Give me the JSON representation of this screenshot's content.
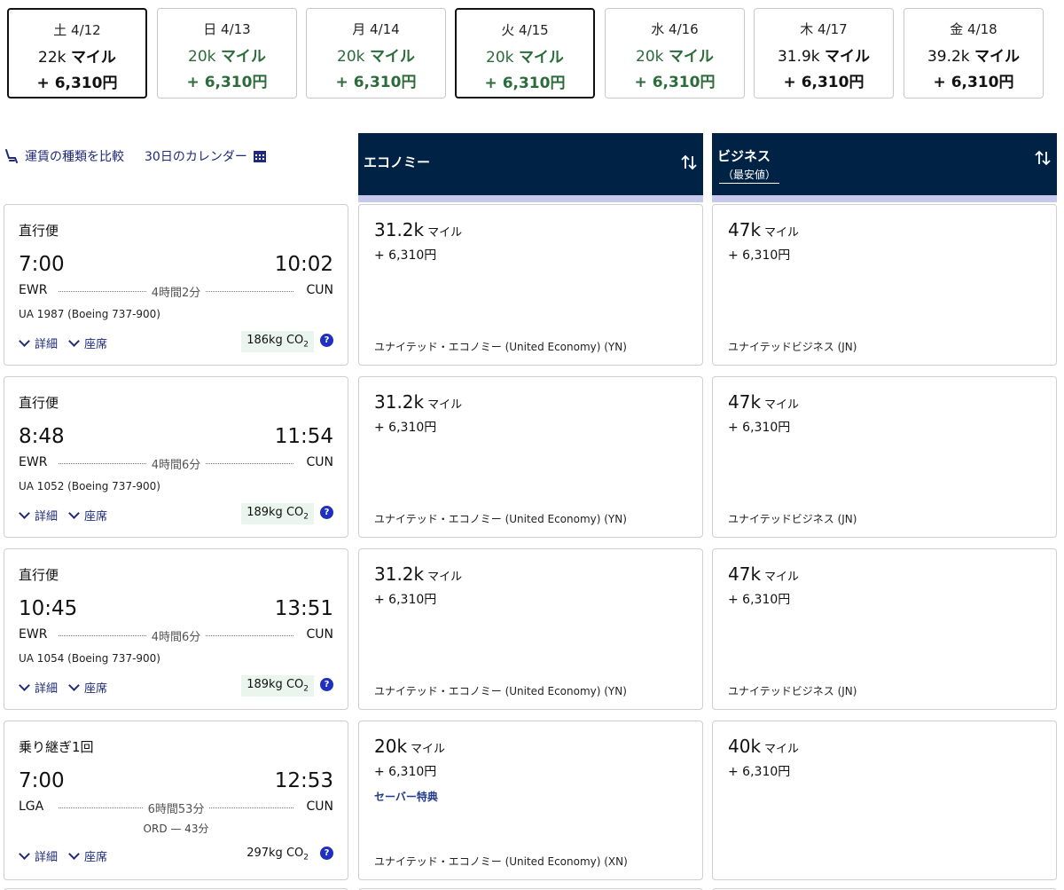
{
  "dates": [
    {
      "label": "土 4/12",
      "miles": "22k",
      "unit": "マイル",
      "fee": "+ 6,310円",
      "selected": true,
      "green": false
    },
    {
      "label": "日 4/13",
      "miles": "20k",
      "unit": "マイル",
      "fee": "+ 6,310円",
      "selected": false,
      "green": true
    },
    {
      "label": "月 4/14",
      "miles": "20k",
      "unit": "マイル",
      "fee": "+ 6,310円",
      "selected": false,
      "green": true
    },
    {
      "label": "火 4/15",
      "miles": "20k",
      "unit": "マイル",
      "fee": "+ 6,310円",
      "selected": true,
      "green": true
    },
    {
      "label": "水 4/16",
      "miles": "20k",
      "unit": "マイル",
      "fee": "+ 6,310円",
      "selected": false,
      "green": true
    },
    {
      "label": "木 4/17",
      "miles": "31.9k",
      "unit": "マイル",
      "fee": "+ 6,310円",
      "selected": false,
      "green": false
    },
    {
      "label": "金 4/18",
      "miles": "39.2k",
      "unit": "マイル",
      "fee": "+ 6,310円",
      "selected": false,
      "green": false
    }
  ],
  "toolbar": {
    "compare_label": "運賃の種類を比較",
    "calendar_label": "30日のカレンダー"
  },
  "headers": {
    "economy": {
      "name": "エコノミー"
    },
    "business": {
      "name": "ビジネス",
      "sub": "（最安値）"
    }
  },
  "flights": [
    {
      "type": "直行便",
      "dep": "7:00",
      "arr": "10:02",
      "from": "EWR",
      "to": "CUN",
      "duration": "4時間2分",
      "flight_no": "UA 1987 (Boeing 737-900)",
      "details": "詳細",
      "seats": "座席",
      "co2": "186kg CO",
      "co2_sub": "2",
      "co2_highlight": true,
      "economy": {
        "miles": "31.2k",
        "unit": "マイル",
        "fee": "+ 6,310円",
        "cabin": "ユナイテッド・エコノミー (United Economy) (YN)"
      },
      "business": {
        "miles": "47k",
        "unit": "マイル",
        "fee": "+ 6,310円",
        "cabin": "ユナイテッドビジネス (JN)"
      }
    },
    {
      "type": "直行便",
      "dep": "8:48",
      "arr": "11:54",
      "from": "EWR",
      "to": "CUN",
      "duration": "4時間6分",
      "flight_no": "UA 1052 (Boeing 737-900)",
      "details": "詳細",
      "seats": "座席",
      "co2": "189kg CO",
      "co2_sub": "2",
      "co2_highlight": true,
      "economy": {
        "miles": "31.2k",
        "unit": "マイル",
        "fee": "+ 6,310円",
        "cabin": "ユナイテッド・エコノミー (United Economy) (YN)"
      },
      "business": {
        "miles": "47k",
        "unit": "マイル",
        "fee": "+ 6,310円",
        "cabin": "ユナイテッドビジネス (JN)"
      }
    },
    {
      "type": "直行便",
      "dep": "10:45",
      "arr": "13:51",
      "from": "EWR",
      "to": "CUN",
      "duration": "4時間6分",
      "flight_no": "UA 1054 (Boeing 737-900)",
      "details": "詳細",
      "seats": "座席",
      "co2": "189kg CO",
      "co2_sub": "2",
      "co2_highlight": true,
      "economy": {
        "miles": "31.2k",
        "unit": "マイル",
        "fee": "+ 6,310円",
        "cabin": "ユナイテッド・エコノミー (United Economy) (YN)"
      },
      "business": {
        "miles": "47k",
        "unit": "マイル",
        "fee": "+ 6,310円",
        "cabin": "ユナイテッドビジネス (JN)"
      }
    },
    {
      "type": "乗り継ぎ1回",
      "dep": "7:00",
      "arr": "12:53",
      "from": "LGA",
      "to": "CUN",
      "duration": "6時間53分",
      "via": "ORD — 43分",
      "details": "詳細",
      "seats": "座席",
      "co2": "297kg CO",
      "co2_sub": "2",
      "co2_highlight": false,
      "economy": {
        "miles": "20k",
        "unit": "マイル",
        "fee": "+ 6,310円",
        "saver": "セーバー特典",
        "cabin": "ユナイテッド・エコノミー (United Economy) (XN)"
      },
      "business": {
        "miles": "40k",
        "unit": "マイル",
        "fee": "+ 6,310円",
        "cabin": ""
      }
    }
  ],
  "colors": {
    "header_bg": "#002244",
    "accent_green": "#2c6b3a",
    "link": "#1f2a7a"
  }
}
